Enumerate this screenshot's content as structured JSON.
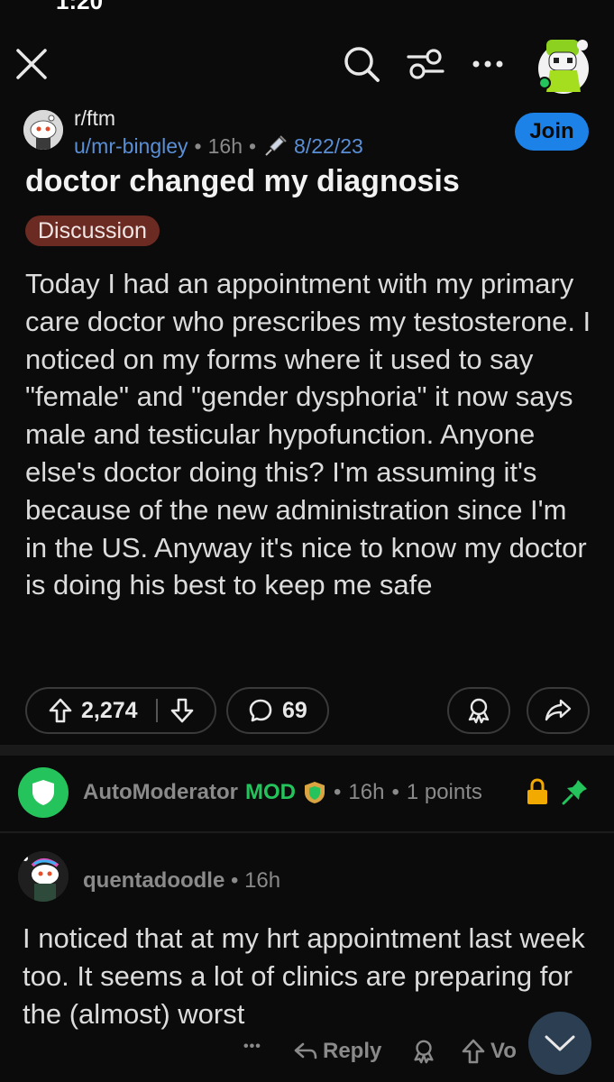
{
  "status_bar": {
    "time": "1:20",
    "icons": "..."
  },
  "topbar": {
    "close_icon": "close-icon",
    "search_icon": "search-icon",
    "filter_icon": "sliders-icon",
    "more_icon": "more-horizontal-icon",
    "avatar_icon": "user-avatar"
  },
  "post": {
    "subreddit": "r/ftm",
    "author": "u/mr-bingley",
    "age": "16h",
    "dot": "•",
    "user_flair_date": "8/22/23",
    "join_label": "Join",
    "title": "doctor changed my diagnosis",
    "flair": "Discussion",
    "body": "Today I had an appointment with my primary care doctor who prescribes my testosterone. I noticed on my forms where it used to say \"female\" and \"gender dysphoria\" it now says male and testicular hypofunction. Anyone else's doctor doing this? I'm assuming it's because of the new administration since I'm in the US. Anyway it's nice to know my doctor is doing his best to keep me safe",
    "votes": "2,274",
    "comments": "69",
    "colors": {
      "accent": "#1d82e8",
      "flair_bg": "#6b2a22"
    }
  },
  "mod_comment": {
    "author": "AutoModerator",
    "tag": "MOD",
    "age": "16h",
    "points": "1 points",
    "dot": "•",
    "colors": {
      "mod": "#24c35b",
      "lock": "#f2a900"
    }
  },
  "comment": {
    "author": "quentadoodle",
    "age": "16h",
    "dot": "•",
    "body": "I noticed that at my hrt appointment last week too. It seems a lot of clinics are preparing for the (almost) worst",
    "more": "•••",
    "reply": "Reply",
    "vote": "Vo"
  }
}
